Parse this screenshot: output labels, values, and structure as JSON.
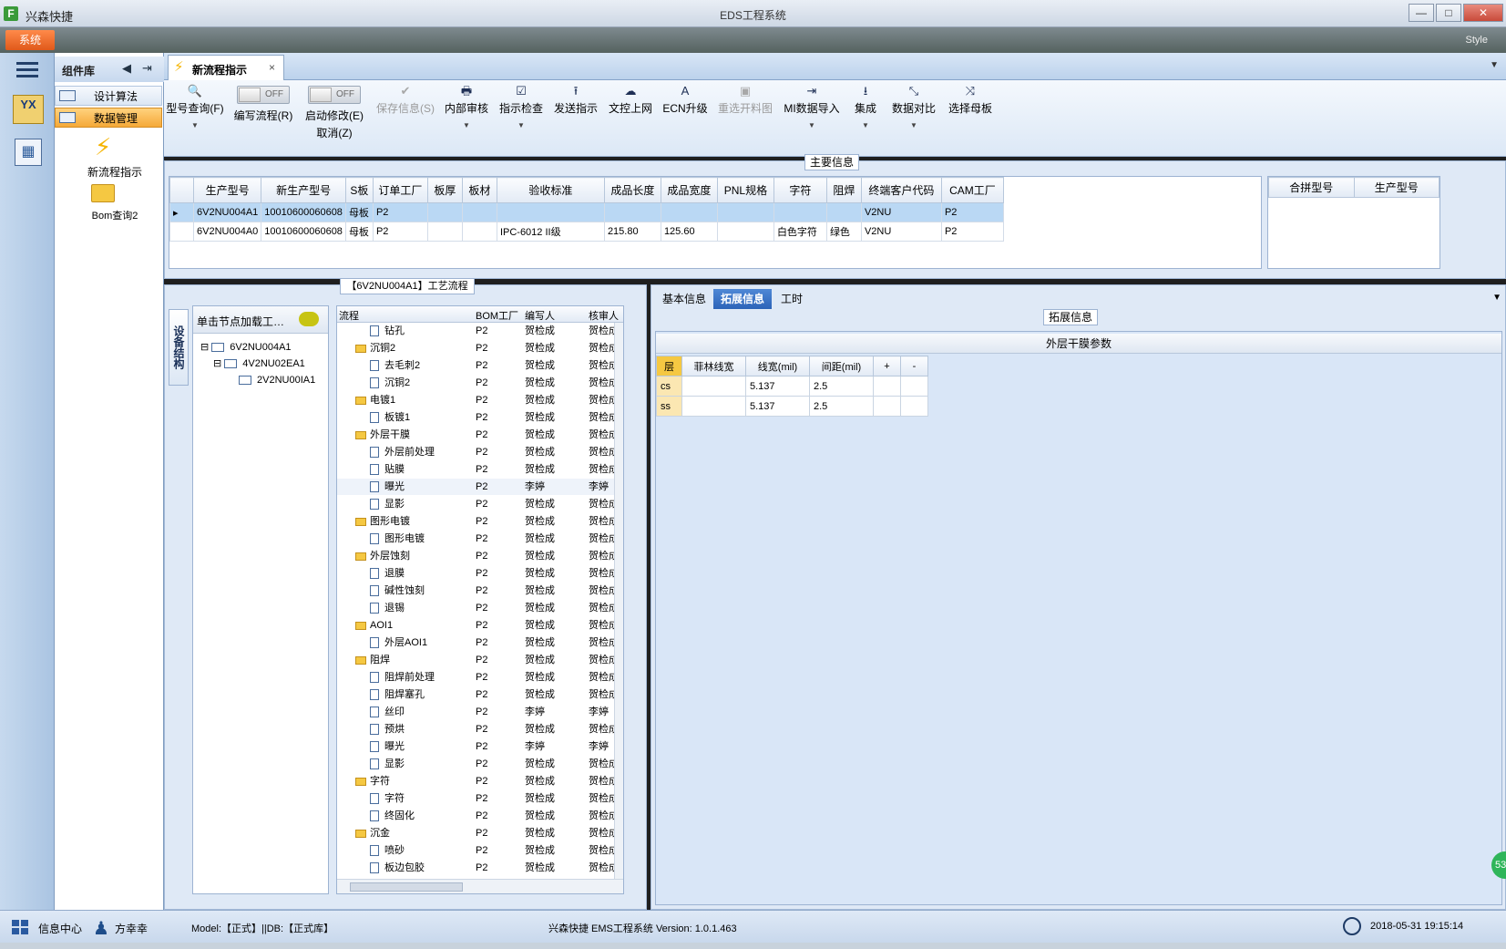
{
  "window": {
    "app_name": "兴森快捷",
    "title": "EDS工程系统",
    "min": "—",
    "max": "□",
    "close": "✕"
  },
  "menu": {
    "system": "系统",
    "style": "Style"
  },
  "component_panel": {
    "title": "组件库",
    "back": "◀",
    "exit": "⇥",
    "items": [
      {
        "label": "设计算法"
      },
      {
        "label": "数据管理"
      }
    ],
    "shortcuts": [
      {
        "label": "新流程指示",
        "icon": "lightning-icon"
      },
      {
        "label": "Bom查询2",
        "icon": "folder-icon"
      }
    ]
  },
  "doc_tab": {
    "label": "新流程指示",
    "close": "×"
  },
  "toolbar": {
    "items": [
      {
        "label": "型号查询(F)",
        "icon": "search-icon",
        "glyph": "🔍",
        "dropdown": true,
        "disabled": false
      },
      {
        "label": "编写流程(R)",
        "toggle": "OFF"
      },
      {
        "label": "启动修改(E)",
        "sublabel": "取消(Z)",
        "toggle": "OFF"
      },
      {
        "label": "保存信息(S)",
        "icon": "check-icon",
        "glyph": "✔",
        "disabled": true
      },
      {
        "label": "内部审核",
        "icon": "print-icon",
        "glyph": "🖶",
        "dropdown": true
      },
      {
        "label": "指示检查",
        "icon": "checkbox-icon",
        "glyph": "☑",
        "dropdown": true
      },
      {
        "label": "发送指示",
        "icon": "upload-icon",
        "glyph": "⭱"
      },
      {
        "label": "文控上网",
        "icon": "cloud-upload-icon",
        "glyph": "☁"
      },
      {
        "label": "ECN升级",
        "icon": "ecn-icon",
        "glyph": "A"
      },
      {
        "label": "重选开料图",
        "icon": "image-icon",
        "glyph": "▣",
        "disabled": true
      },
      {
        "label": "MI数据导入",
        "icon": "import-icon",
        "glyph": "⇥",
        "dropdown": true
      },
      {
        "label": "集成",
        "icon": "download-icon",
        "glyph": "⭳",
        "dropdown": true
      },
      {
        "label": "数据对比",
        "icon": "compare-icon",
        "glyph": "⤡",
        "dropdown": true
      },
      {
        "label": "选择母板",
        "icon": "shuffle-icon",
        "glyph": "⤨"
      }
    ]
  },
  "main_info": {
    "caption": "主要信息",
    "columns": [
      "生产型号",
      "新生产型号",
      "S板",
      "订单工厂",
      "板厚",
      "板材",
      "验收标准",
      "成品长度",
      "成品宽度",
      "PNL规格",
      "字符",
      "阻焊",
      "终端客户代码",
      "CAM工厂"
    ],
    "rows": [
      [
        "6V2NU004A1",
        "10010600060608",
        "母板",
        "P2",
        "",
        "",
        "",
        "",
        "",
        "",
        "",
        "",
        "V2NU",
        "P2"
      ],
      [
        "6V2NU004A0",
        "10010600060608",
        "母板",
        "P2",
        "",
        "",
        "IPC-6012 II级",
        "215.80",
        "125.60",
        "",
        "白色字符",
        "绿色",
        "V2NU",
        "P2"
      ]
    ],
    "side_columns": [
      "合拼型号",
      "生产型号"
    ]
  },
  "structure": {
    "caption": "【6V2NU004A1】工艺流程",
    "side_tab": "设备结构",
    "load_hint": "单击节点加载工…",
    "tree": [
      "6V2NU004A1",
      "4V2NU02EA1",
      "2V2NU00IA1"
    ],
    "flow_columns": [
      "流程",
      "BOM工厂",
      "编写人",
      "核审人"
    ],
    "flow_rows": [
      {
        "name": "钻孔",
        "level": 2,
        "factory": "P2",
        "writer": "贺检成",
        "reviewer": "贺检成"
      },
      {
        "name": "沉铜2",
        "level": 1,
        "factory": "P2",
        "writer": "贺检成",
        "reviewer": "贺检成"
      },
      {
        "name": "去毛刺2",
        "level": 2,
        "factory": "P2",
        "writer": "贺检成",
        "reviewer": "贺检成"
      },
      {
        "name": "沉铜2",
        "level": 2,
        "factory": "P2",
        "writer": "贺检成",
        "reviewer": "贺检成"
      },
      {
        "name": "电镀1",
        "level": 1,
        "factory": "P2",
        "writer": "贺检成",
        "reviewer": "贺检成"
      },
      {
        "name": "板镀1",
        "level": 2,
        "factory": "P2",
        "writer": "贺检成",
        "reviewer": "贺检成"
      },
      {
        "name": "外层干膜",
        "level": 1,
        "factory": "P2",
        "writer": "贺检成",
        "reviewer": "贺检成"
      },
      {
        "name": "外层前处理",
        "level": 2,
        "factory": "P2",
        "writer": "贺检成",
        "reviewer": "贺检成"
      },
      {
        "name": "贴膜",
        "level": 2,
        "factory": "P2",
        "writer": "贺检成",
        "reviewer": "贺检成"
      },
      {
        "name": "曝光",
        "level": 2,
        "factory": "P2",
        "writer": "李婷",
        "reviewer": "李婷",
        "highlight": true
      },
      {
        "name": "显影",
        "level": 2,
        "factory": "P2",
        "writer": "贺检成",
        "reviewer": "贺检成"
      },
      {
        "name": "图形电镀",
        "level": 1,
        "factory": "P2",
        "writer": "贺检成",
        "reviewer": "贺检成"
      },
      {
        "name": "图形电镀",
        "level": 2,
        "factory": "P2",
        "writer": "贺检成",
        "reviewer": "贺检成"
      },
      {
        "name": "外层蚀刻",
        "level": 1,
        "factory": "P2",
        "writer": "贺检成",
        "reviewer": "贺检成"
      },
      {
        "name": "退膜",
        "level": 2,
        "factory": "P2",
        "writer": "贺检成",
        "reviewer": "贺检成"
      },
      {
        "name": "碱性蚀刻",
        "level": 2,
        "factory": "P2",
        "writer": "贺检成",
        "reviewer": "贺检成"
      },
      {
        "name": "退锡",
        "level": 2,
        "factory": "P2",
        "writer": "贺检成",
        "reviewer": "贺检成"
      },
      {
        "name": "AOI1",
        "level": 1,
        "factory": "P2",
        "writer": "贺检成",
        "reviewer": "贺检成"
      },
      {
        "name": "外层AOI1",
        "level": 2,
        "factory": "P2",
        "writer": "贺检成",
        "reviewer": "贺检成"
      },
      {
        "name": "阻焊",
        "level": 1,
        "factory": "P2",
        "writer": "贺检成",
        "reviewer": "贺检成"
      },
      {
        "name": "阻焊前处理",
        "level": 2,
        "factory": "P2",
        "writer": "贺检成",
        "reviewer": "贺检成"
      },
      {
        "name": "阻焊塞孔",
        "level": 2,
        "factory": "P2",
        "writer": "贺检成",
        "reviewer": "贺检成"
      },
      {
        "name": "丝印",
        "level": 2,
        "factory": "P2",
        "writer": "李婷",
        "reviewer": "李婷"
      },
      {
        "name": "预烘",
        "level": 2,
        "factory": "P2",
        "writer": "贺检成",
        "reviewer": "贺检成"
      },
      {
        "name": "曝光",
        "level": 2,
        "factory": "P2",
        "writer": "李婷",
        "reviewer": "李婷"
      },
      {
        "name": "显影",
        "level": 2,
        "factory": "P2",
        "writer": "贺检成",
        "reviewer": "贺检成"
      },
      {
        "name": "字符",
        "level": 1,
        "factory": "P2",
        "writer": "贺检成",
        "reviewer": "贺检成"
      },
      {
        "name": "字符",
        "level": 2,
        "factory": "P2",
        "writer": "贺检成",
        "reviewer": "贺检成"
      },
      {
        "name": "终固化",
        "level": 2,
        "factory": "P2",
        "writer": "贺检成",
        "reviewer": "贺检成"
      },
      {
        "name": "沉金",
        "level": 1,
        "factory": "P2",
        "writer": "贺检成",
        "reviewer": "贺检成"
      },
      {
        "name": "喷砂",
        "level": 2,
        "factory": "P2",
        "writer": "贺检成",
        "reviewer": "贺检成"
      },
      {
        "name": "板边包胶",
        "level": 2,
        "factory": "P2",
        "writer": "贺检成",
        "reviewer": "贺检成"
      }
    ]
  },
  "detail": {
    "tabs": [
      "基本信息",
      "拓展信息",
      "工时"
    ],
    "active_tab": 1,
    "caption": "拓展信息",
    "title": "外层干膜参数",
    "columns": [
      "层",
      "菲林线宽",
      "线宽(mil)",
      "间距(mil)",
      "+",
      "-"
    ],
    "rows": [
      [
        "cs",
        "",
        "5.137",
        "2.5",
        "",
        ""
      ],
      [
        "ss",
        "",
        "5.137",
        "2.5",
        "",
        ""
      ]
    ]
  },
  "status": {
    "info_center": "信息中心",
    "user": "方幸幸",
    "model": "Model:【正式】||DB:【正式库】",
    "system": "兴森快捷 EMS工程系统 Version: 1.0.1.463",
    "datetime": "2018-05-31 19:15:14",
    "badge": "53"
  }
}
